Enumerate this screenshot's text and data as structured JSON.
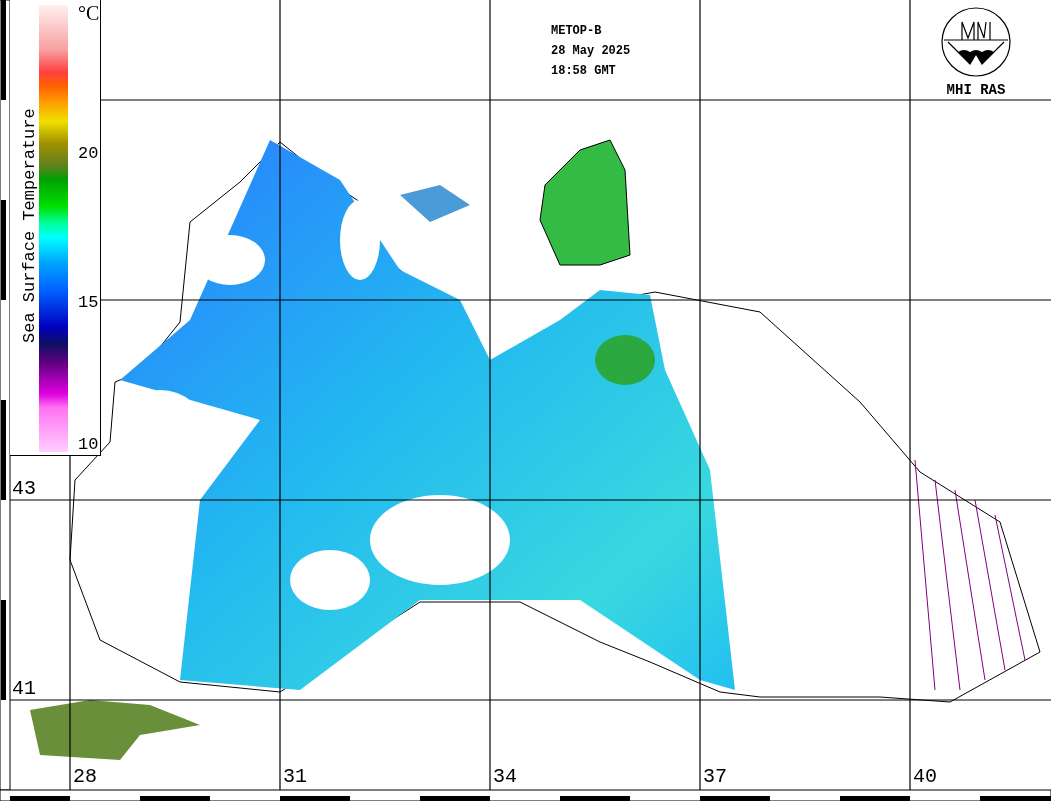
{
  "legend": {
    "title": "Sea Surface Temperature",
    "unit": "°C",
    "ticks": [
      "20",
      "15",
      "10"
    ]
  },
  "header": {
    "satellite": "METOP-B",
    "date": "28 May 2025",
    "time": "18:58 GMT"
  },
  "logo": {
    "text": "MHI RAS"
  },
  "latitude_labels": [
    "43",
    "41"
  ],
  "longitude_labels": [
    "28",
    "31",
    "34",
    "37",
    "40"
  ]
}
